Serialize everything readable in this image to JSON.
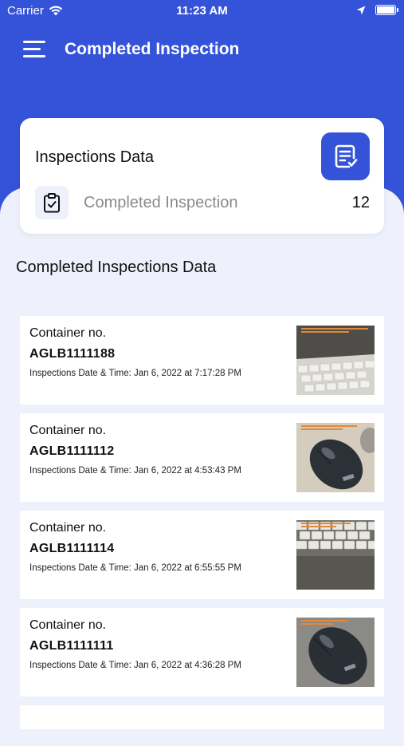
{
  "status_bar": {
    "carrier": "Carrier",
    "time": "11:23 AM"
  },
  "header": {
    "title": "Completed Inspection"
  },
  "summary": {
    "title": "Inspections Data",
    "completed_label": "Completed Inspection",
    "completed_count": "12"
  },
  "section_title": "Completed Inspections Data",
  "inspections": [
    {
      "label": "Container no.",
      "number": "AGLB1111188",
      "date": "Inspections Date & Time: Jan 6, 2022 at 7:17:28 PM",
      "photo": "keyboard"
    },
    {
      "label": "Container no.",
      "number": "AGLB1111112",
      "date": "Inspections Date & Time: Jan 6, 2022 at 4:53:43 PM",
      "photo": "mouse"
    },
    {
      "label": "Container no.",
      "number": "AGLB1111114",
      "date": "Inspections Date & Time: Jan 6, 2022 at 6:55:55 PM",
      "photo": "keyboard"
    },
    {
      "label": "Container no.",
      "number": "AGLB1111111",
      "date": "Inspections Date & Time: Jan 6, 2022 at 4:36:28 PM",
      "photo": "mouse"
    }
  ],
  "colors": {
    "brand_blue": "#3553d9",
    "background": "#eef0fb",
    "card": "#ffffff"
  }
}
